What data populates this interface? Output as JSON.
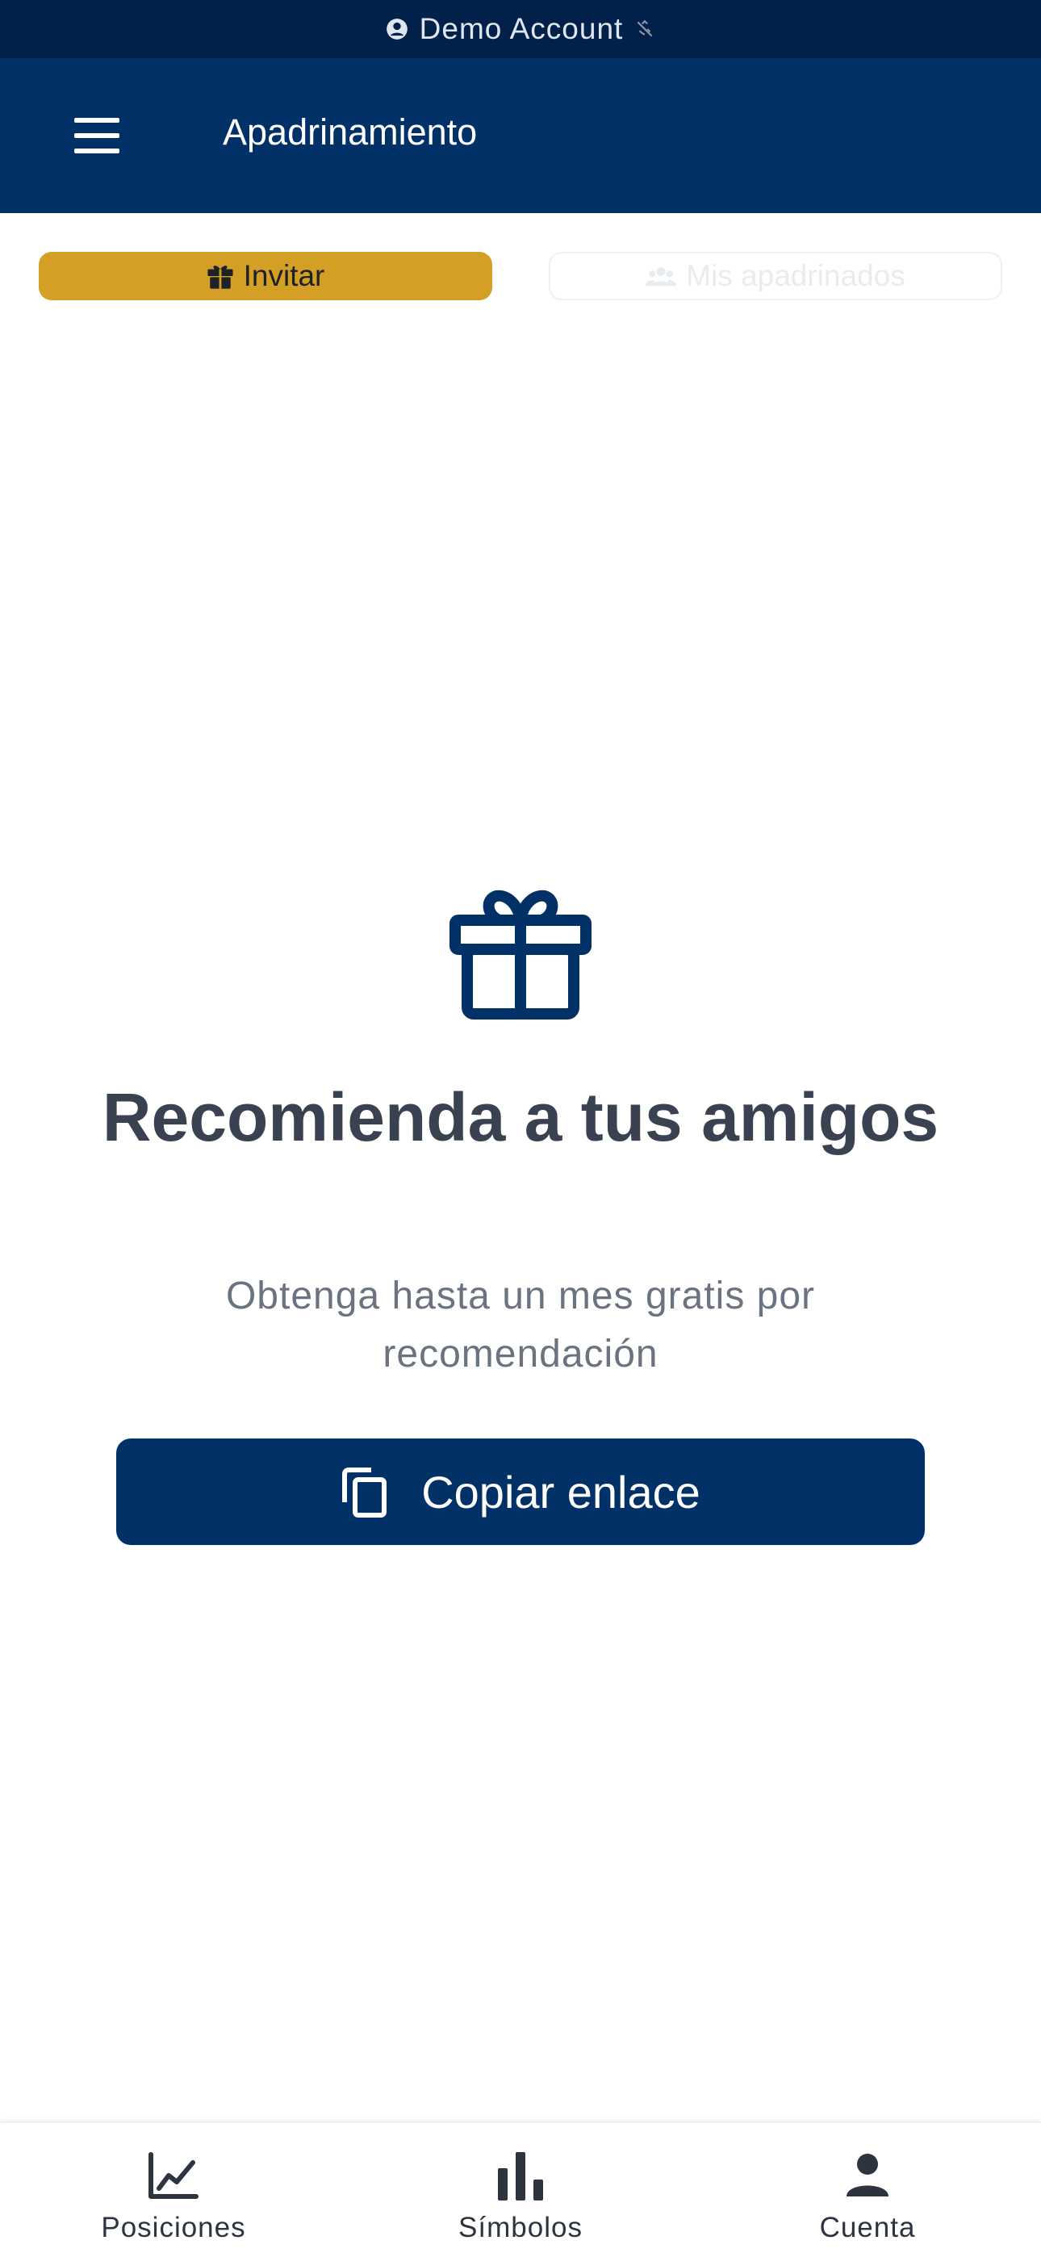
{
  "demo_bar": {
    "text": "Demo Account"
  },
  "header": {
    "title": "Apadrinamiento"
  },
  "tabs": [
    {
      "label": "Invitar",
      "active": true
    },
    {
      "label": "Mis apadrinados",
      "active": false
    }
  ],
  "main": {
    "title": "Recomienda a tus amigos",
    "subtitle": "Obtenga hasta un mes gratis por recomendación",
    "copy_button": "Copiar enlace"
  },
  "bottom_nav": [
    {
      "label": "Posiciones",
      "icon": "chart-line-icon"
    },
    {
      "label": "Símbolos",
      "icon": "bar-chart-icon"
    },
    {
      "label": "Cuenta",
      "icon": "person-icon"
    }
  ],
  "colors": {
    "demo_bar": "#01214a",
    "header": "#013166",
    "accent": "#d3a025",
    "primary_button": "#013166"
  }
}
